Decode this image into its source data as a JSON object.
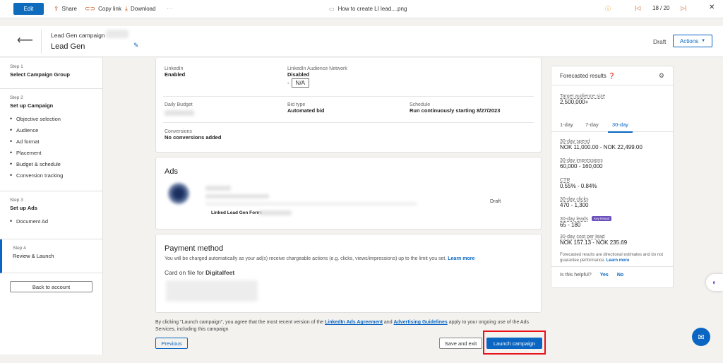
{
  "topbar": {
    "edit_label": "Edit",
    "share_label": "Share",
    "copy_link_label": "Copy link",
    "download_label": "Download",
    "more_label": "···",
    "file_name": "How to create LI lead....png",
    "page_counter": "18 / 20"
  },
  "header": {
    "campaign_name": "Lead Gen campaign",
    "campaign_title": "Lead Gen",
    "status": "Draft",
    "actions_label": "Actions"
  },
  "sidebar": {
    "steps": [
      {
        "num": "Step 1",
        "title": "Select Campaign Group",
        "items": []
      },
      {
        "num": "Step 2",
        "title": "Set up Campaign",
        "items": [
          "Objective selection",
          "Audience",
          "Ad format",
          "Placement",
          "Budget & schedule",
          "Conversion tracking"
        ]
      },
      {
        "num": "Step 3",
        "title": "Set up Ads",
        "items": [
          "Document Ad"
        ]
      },
      {
        "num": "Step 4",
        "title": "Review & Launch",
        "items": []
      }
    ],
    "back_label": "Back to account"
  },
  "summary": {
    "linkedin_label": "LinkedIn",
    "linkedin_value": "Enabled",
    "lan_label": "LinkedIn Audience Network",
    "lan_value": "Disabled",
    "lan_na_prefix": "-",
    "lan_na": "N/A",
    "budget_label": "Daily Budget",
    "bid_label": "Bid type",
    "bid_value": "Automated bid",
    "schedule_label": "Schedule",
    "schedule_value": "Run continuously starting 8/27/2023",
    "conversions_label": "Conversions",
    "conversions_value": "No conversions added"
  },
  "ads": {
    "heading": "Ads",
    "status": "Draft",
    "form_label": "Linked Lead Gen Form:"
  },
  "payment": {
    "heading": "Payment method",
    "description": "You will be charged automatically as your ad(s) receive chargeable actions (e.g. clicks, views/impressions) up to the limit you set.",
    "learn_more": "Learn more",
    "card_prefix": "Card on file for",
    "card_owner": "Digitalfeet"
  },
  "forecast": {
    "title": "Forecasted results",
    "audience_label": "Target audience size",
    "audience_value": "2,500,000+",
    "tabs": [
      "1-day",
      "7-day",
      "30-day"
    ],
    "active_tab": "30-day",
    "metrics": [
      {
        "label": "30-day spend",
        "value": "NOK 11,000.00 - NOK 22,499.00"
      },
      {
        "label": "30-day impressions",
        "value": "60,000 - 160,000"
      },
      {
        "label": "CTR",
        "value": "0.55% - 0.84%"
      },
      {
        "label": "30-day clicks",
        "value": "470 - 1,300"
      },
      {
        "label": "30-day leads",
        "value": "65 - 180",
        "badge": "Key Result"
      },
      {
        "label": "30-day cost per lead",
        "value": "NOK 157.13 - NOK 235.69"
      }
    ],
    "note": "Forecasted results are directional estimates and do not guarantee performance.",
    "note_link": "Learn more",
    "helpful_q": "Is this helpful?",
    "yes": "Yes",
    "no": "No"
  },
  "footer": {
    "disclaimer_1": "By clicking \"Launch campaign\", you agree that the most recent version of the",
    "agreement_link": "LinkedIn Ads Agreement",
    "and_word": "and",
    "guidelines_link": "Advertising Guidelines",
    "disclaimer_2": "apply to your ongoing use of the Ads Services, including this campaign",
    "previous_label": "Previous",
    "save_exit_label": "Save and exit",
    "launch_label": "Launch campaign"
  },
  "colors": {
    "accent": "#0a66c2",
    "highlight_box": "#e8101a",
    "key_result_badge": "#6b4fbb"
  }
}
